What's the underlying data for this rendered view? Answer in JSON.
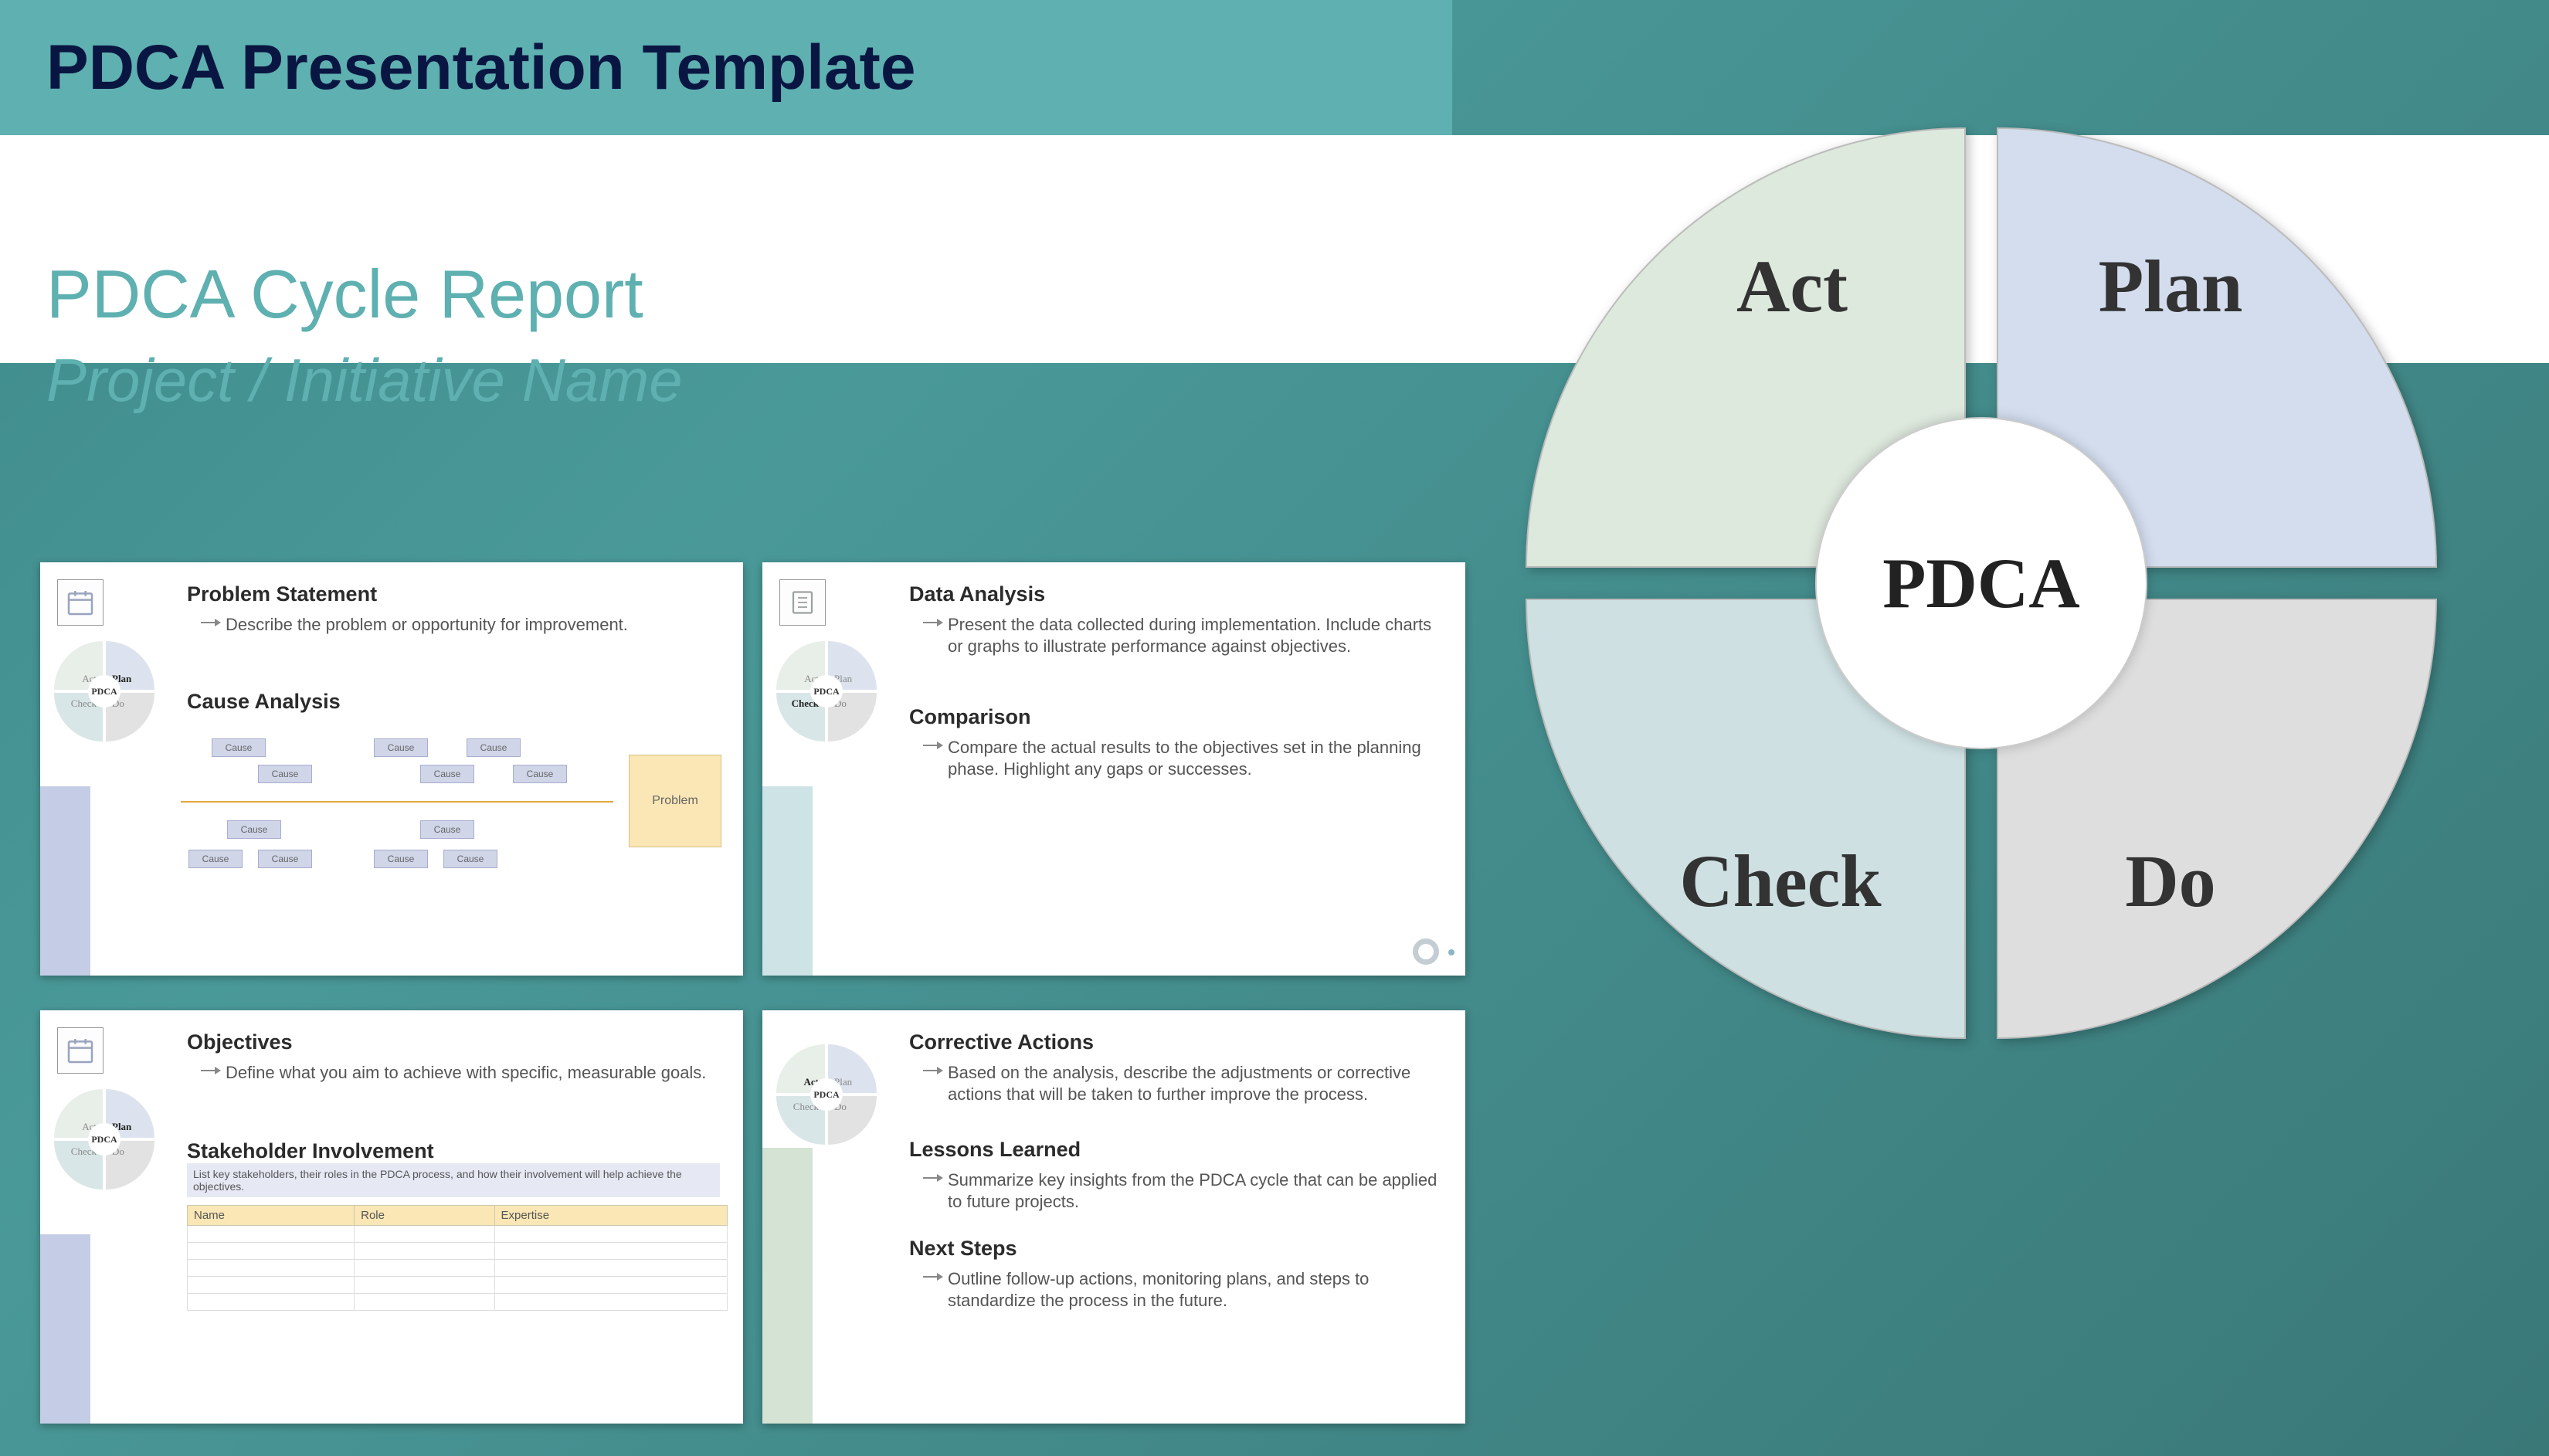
{
  "header": {
    "title": "PDCA Presentation Template"
  },
  "subtitle1": "PDCA Cycle Report",
  "subtitle2": "Project / Initiative Name",
  "wheel": {
    "act": "Act",
    "plan": "Plan",
    "check": "Check",
    "do": "Do",
    "center": "PDCA"
  },
  "mini": {
    "act": "Act",
    "plan": "Plan",
    "check": "Check",
    "do": "Do",
    "center": "PDCA"
  },
  "thumbs": [
    {
      "highlight": "plan",
      "blockColor": "#c4cde5",
      "s1_title": "Problem Statement",
      "s1_body": "Describe the problem or opportunity for improvement.",
      "s2_title": "Cause Analysis",
      "fishbone": {
        "problem": "Problem",
        "cause": "Cause"
      }
    },
    {
      "highlight": "check",
      "blockColor": "#cee3e5",
      "s1_title": "Data Analysis",
      "s1_body": "Present the data collected during implementation. Include charts or graphs to illustrate performance against objectives.",
      "s2_title": "Comparison",
      "s2_body": "Compare the actual results to the objectives set in the planning phase. Highlight any gaps or successes."
    },
    {
      "highlight": "plan",
      "blockColor": "#c4cde5",
      "s1_title": "Objectives",
      "s1_body": "Define what you aim to achieve with specific, measurable goals.",
      "s2_title": "Stakeholder Involvement",
      "table_caption": "List key stakeholders, their roles in the PDCA process, and how their involvement will help achieve the objectives.",
      "table_cols": [
        "Name",
        "Role",
        "Expertise"
      ]
    },
    {
      "highlight": "act",
      "blockColor": "#d4e3d4",
      "s1_title": "Corrective Actions",
      "s1_body": "Based on the analysis, describe the adjustments or corrective actions that will be taken to further improve the process.",
      "s2_title": "Lessons Learned",
      "s2_body": "Summarize key insights from the PDCA cycle that can be applied to future projects.",
      "s3_title": "Next Steps",
      "s3_body": "Outline follow-up actions, monitoring plans, and steps to standardize the process in the future."
    }
  ]
}
